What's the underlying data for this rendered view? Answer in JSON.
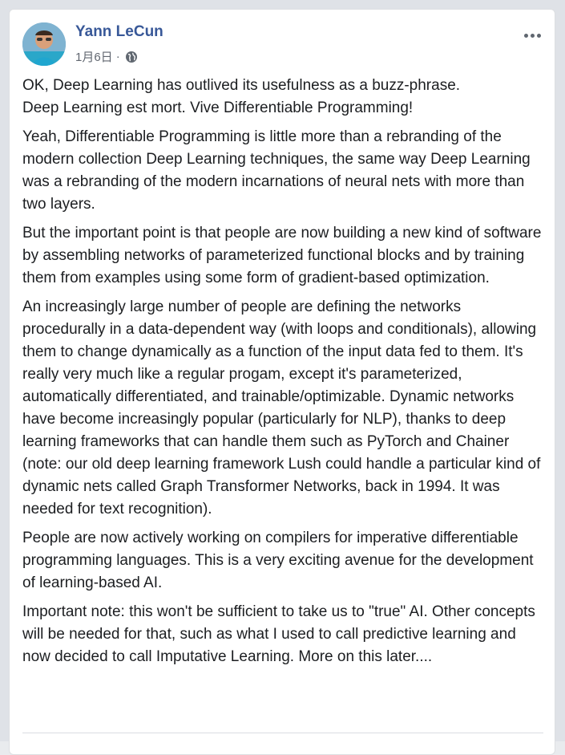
{
  "post": {
    "author": "Yann LeCun",
    "date": "1月6日",
    "separator": "·",
    "privacy_icon": "globe-icon",
    "more_icon": "more-options-icon",
    "paragraphs": [
      "OK, Deep Learning has outlived its usefulness as a buzz-phrase.\nDeep Learning est mort. Vive Differentiable Programming!",
      "Yeah, Differentiable Programming is little more than a rebranding of the modern collection Deep Learning techniques, the same way Deep Learning was a rebranding of the modern incarnations of neural nets with more than two layers.",
      "But the important point is that people are now building a new kind of software by assembling networks of parameterized functional blocks and by training them from examples using some form of gradient-based optimization.",
      "An increasingly large number of people are defining the networks procedurally in a data-dependent way (with loops and conditionals), allowing them to change dynamically as a function of the input data fed to them. It's really very much like a regular progam, except it's parameterized, automatically differentiated, and trainable/optimizable. Dynamic networks have become increasingly popular (particularly for NLP), thanks to deep learning frameworks that can handle them such as PyTorch and Chainer (note: our old deep learning framework Lush could handle a particular kind of dynamic nets called Graph Transformer Networks, back in 1994. It was needed for text recognition).",
      "People are now actively working on compilers for imperative differentiable programming languages. This is a very exciting avenue for the development of learning-based AI.",
      "Important note: this won't be sufficient to take us to \"true\" AI. Other concepts will be needed for that, such as what I used to call predictive learning and now decided to call Imputative Learning. More on this later...."
    ]
  },
  "colors": {
    "author": "#385898",
    "text": "#1c1e21",
    "meta": "#616770"
  }
}
